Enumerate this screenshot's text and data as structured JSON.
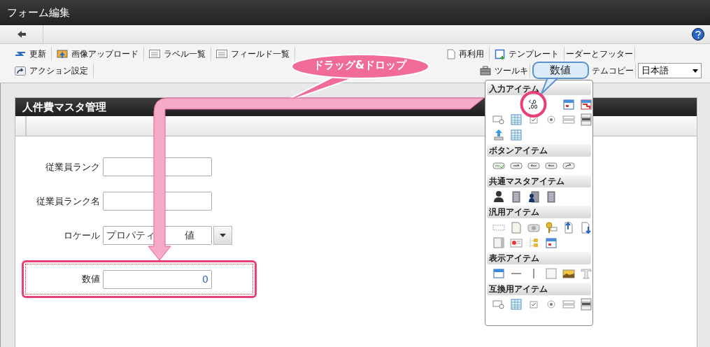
{
  "window": {
    "title": "フォーム編集"
  },
  "toolbar": {
    "rows": [
      [
        {
          "kind": "button",
          "label": "更新"
        },
        {
          "kind": "button",
          "label": "画像アップロード"
        },
        {
          "kind": "button",
          "label": "ラベル一覧"
        },
        {
          "kind": "button",
          "label": "フィールド一覧"
        },
        {
          "kind": "spring"
        },
        {
          "kind": "button",
          "label": "再利用"
        },
        {
          "kind": "button",
          "label": "テンプレート"
        },
        {
          "kind": "button",
          "label": "ーダーとフッター"
        },
        {
          "kind": "tail"
        }
      ],
      [
        {
          "kind": "button",
          "label": "アクション設定"
        },
        {
          "kind": "spring"
        },
        {
          "kind": "button",
          "label": "ツールキ"
        },
        {
          "kind": "gap"
        },
        {
          "kind": "button",
          "label": "テムコピー"
        },
        {
          "kind": "select",
          "value": "日本語"
        }
      ]
    ]
  },
  "form": {
    "title": "人件費マスタ管理",
    "fields": [
      {
        "kind": "text",
        "label": "従業員ランク",
        "highlighted": false
      },
      {
        "kind": "text",
        "label": "従業員ランク名",
        "highlighted": false
      },
      {
        "kind": "select",
        "label": "ロケール",
        "value_start": "プロパティ",
        "value_end": "値",
        "highlighted": false
      },
      {
        "kind": "number",
        "label": "数値",
        "value_start": "0",
        "highlighted": true
      }
    ]
  },
  "palette": {
    "sections": [
      {
        "title": "入力アイテム",
        "items": [
          {
            "kind": "covered"
          },
          {
            "kind": "covered"
          },
          {
            "kind": "numeric",
            "circled": true
          },
          {
            "kind": "covered"
          },
          {
            "kind": "calendar"
          },
          {
            "kind": "calendar-red"
          },
          {
            "kind": "search-box"
          },
          {
            "kind": "table"
          },
          {
            "kind": "checkbox"
          },
          {
            "kind": "radio"
          },
          {
            "kind": "list"
          },
          {
            "kind": "listbox"
          },
          {
            "kind": "upload"
          },
          {
            "kind": "table"
          }
        ]
      },
      {
        "title": "ボタンアイテム",
        "items": [
          {
            "kind": "button-check"
          },
          {
            "kind": "button-right"
          },
          {
            "kind": "button-left"
          },
          {
            "kind": "button-left"
          },
          {
            "kind": "button-curve"
          }
        ]
      },
      {
        "title": "共通マスタアイテム",
        "items": [
          {
            "kind": "person"
          },
          {
            "kind": "building"
          },
          {
            "kind": "person-building"
          },
          {
            "kind": "building"
          }
        ]
      },
      {
        "title": "汎用アイテム",
        "items": [
          {
            "kind": "dashed"
          },
          {
            "kind": "document"
          },
          {
            "kind": "camera"
          },
          {
            "kind": "key"
          },
          {
            "kind": "file-up"
          },
          {
            "kind": "file-down"
          },
          {
            "kind": "panel"
          },
          {
            "kind": "card"
          },
          {
            "kind": "tree"
          },
          {
            "kind": "calendar"
          }
        ]
      },
      {
        "title": "表示アイテム",
        "items": [
          {
            "kind": "label"
          },
          {
            "kind": "hline"
          },
          {
            "kind": "vline"
          },
          {
            "kind": "square"
          },
          {
            "kind": "image"
          },
          {
            "kind": "text-t"
          }
        ]
      },
      {
        "title": "互換用アイテム",
        "items": [
          {
            "kind": "search-box"
          },
          {
            "kind": "table"
          },
          {
            "kind": "checkbox"
          },
          {
            "kind": "radio"
          },
          {
            "kind": "list"
          },
          {
            "kind": "listbox"
          }
        ]
      }
    ]
  },
  "annotations": [
    {
      "kind": "pink-callout",
      "text": "ドラッグ&ドロップ"
    },
    {
      "kind": "blue-callout",
      "text": "数値"
    },
    {
      "kind": "drag-arrow"
    }
  ]
}
